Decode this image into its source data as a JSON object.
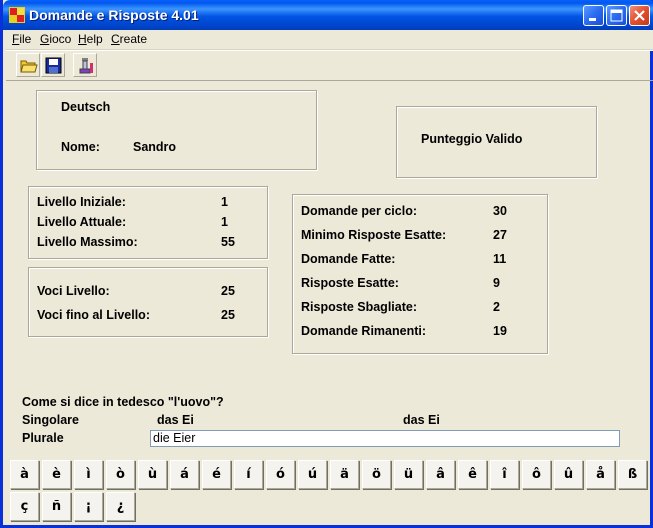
{
  "window": {
    "title": "Domande e Risposte 4.01",
    "colors": {
      "titlebar": "#0054E3",
      "face": "#ECE9D8"
    }
  },
  "menu": {
    "items": [
      {
        "label": "File",
        "underline": "F",
        "rest": "ile"
      },
      {
        "label": "Gioco",
        "underline": "G",
        "rest": "ioco"
      },
      {
        "label": "Help",
        "underline": "H",
        "rest": "elp"
      },
      {
        "label": "Create",
        "underline": "C",
        "rest": "reate"
      }
    ]
  },
  "toolbar": {
    "icons": [
      "open-folder-icon",
      "save-disk-icon",
      "flask-icon"
    ]
  },
  "language_box": {
    "language": "Deutsch",
    "name_label": "Nome:",
    "name_value": "Sandro"
  },
  "score_box": {
    "label": "Punteggio Valido"
  },
  "levels": {
    "initial_label": "Livello Iniziale:",
    "initial_value": "1",
    "current_label": "Livello Attuale:",
    "current_value": "1",
    "max_label": "Livello Massimo:",
    "max_value": "55"
  },
  "voices": {
    "level_label": "Voci Livello:",
    "level_value": "25",
    "upto_label": "Voci fino al Livello:",
    "upto_value": "25"
  },
  "stats": {
    "rows": [
      {
        "label": "Domande per ciclo:",
        "value": "30"
      },
      {
        "label": "Minimo Risposte Esatte:",
        "value": "27"
      },
      {
        "label": "Domande Fatte:",
        "value": "11"
      },
      {
        "label": "Risposte Esatte:",
        "value": "9"
      },
      {
        "label": "Risposte Sbagliate:",
        "value": "2"
      },
      {
        "label": "Domande Rimanenti:",
        "value": "19"
      }
    ]
  },
  "question": {
    "text": "Come si dice in tedesco \"l'uovo\"?",
    "singular_label": "Singolare",
    "singular_answer": "das Ei",
    "singular_correct": "das Ei",
    "plural_label": "Plurale",
    "plural_input_value": "die Eier"
  },
  "keyboard": {
    "row1": [
      "à",
      "è",
      "ì",
      "ò",
      "ù",
      "á",
      "é",
      "í",
      "ó",
      "ú",
      "ä",
      "ö",
      "ü",
      "â",
      "ê",
      "î",
      "ô",
      "û",
      "å",
      "ß"
    ],
    "row2": [
      "ç",
      "ñ",
      "¡",
      "¿"
    ]
  }
}
